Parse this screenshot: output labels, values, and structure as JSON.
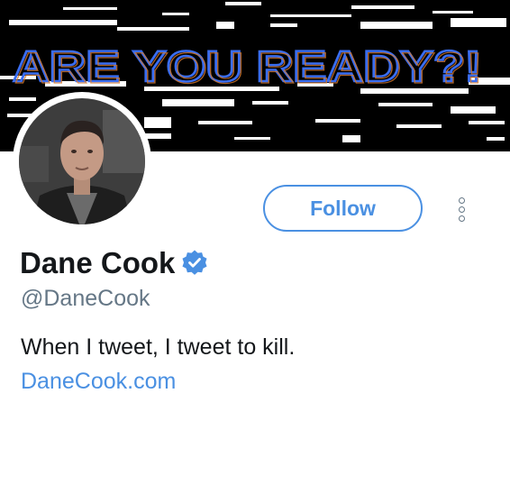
{
  "banner": {
    "text": "ARE YOU READY?!",
    "neon_colors": [
      "#3a6df0",
      "#d77a2c",
      "#7bc4ff"
    ]
  },
  "profile": {
    "display_name": "Dane Cook",
    "verified": true,
    "handle": "@DaneCook",
    "bio": "When I tweet, I tweet to kill.",
    "website": "DaneCook.com"
  },
  "actions": {
    "follow_label": "Follow",
    "more_icon": "more-vertical-icon"
  },
  "colors": {
    "accent": "#4a90e2",
    "verified_badge": "#4a90e2",
    "secondary_text": "#657786",
    "primary_text": "#14171a"
  }
}
